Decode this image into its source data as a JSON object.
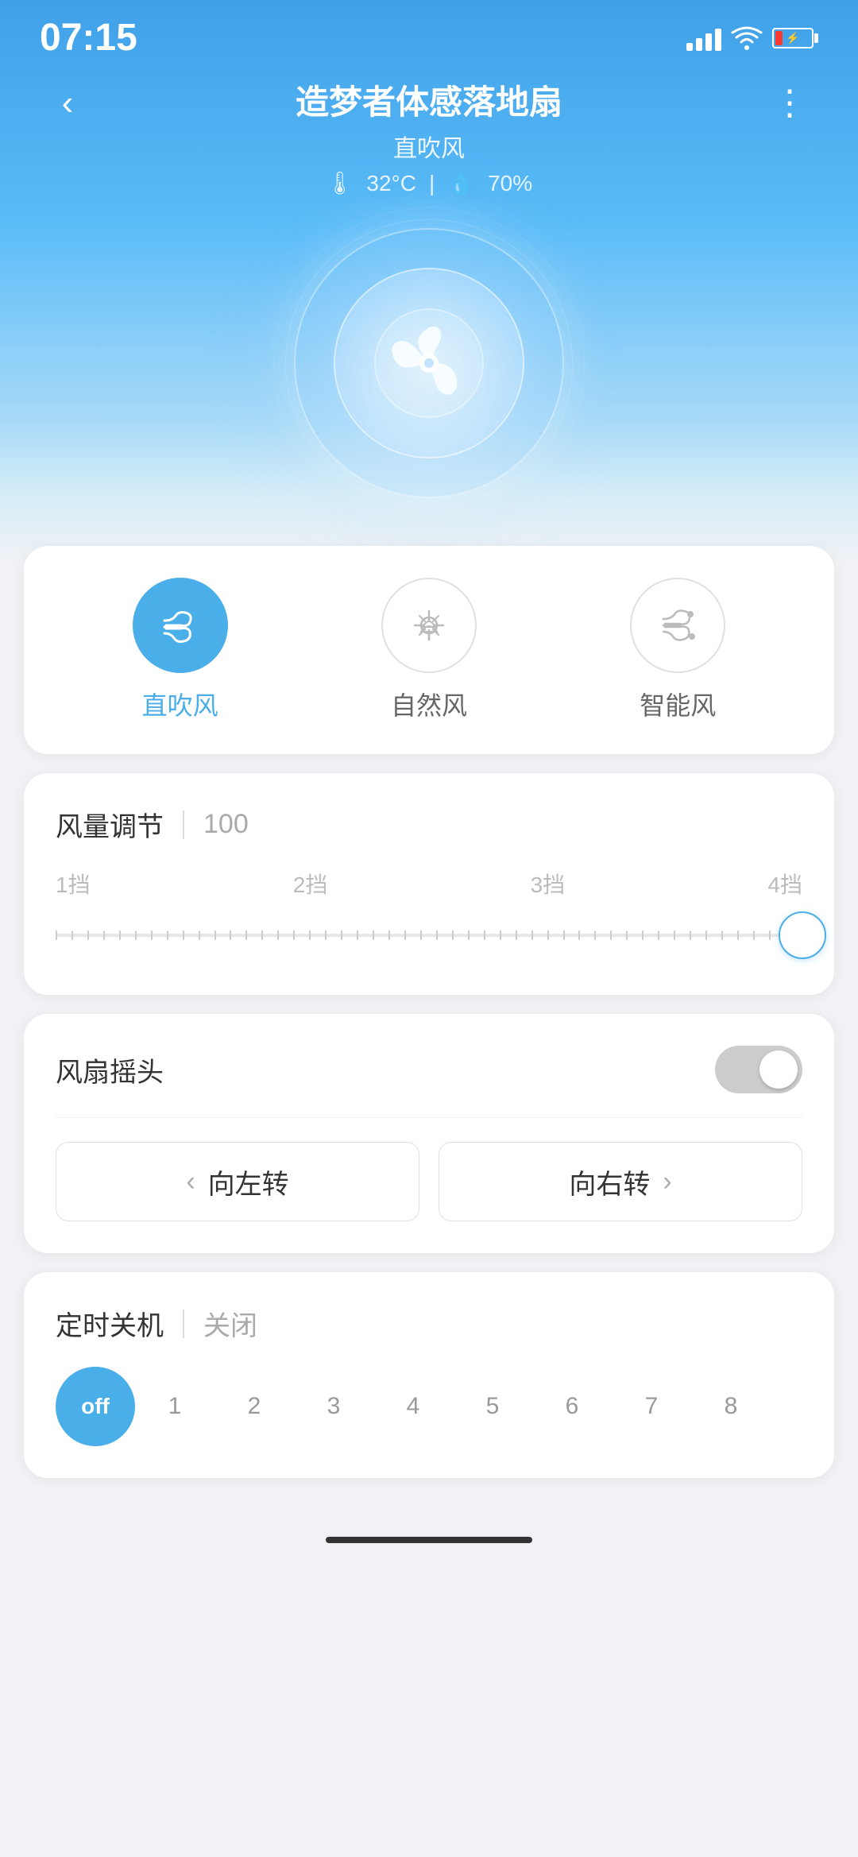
{
  "statusBar": {
    "time": "07:15"
  },
  "header": {
    "title": "造梦者体感落地扇",
    "subtitle": "直吹风",
    "temperature": "32°C",
    "humidity": "70%",
    "backLabel": "<",
    "moreLabel": "⋮"
  },
  "windModes": {
    "items": [
      {
        "id": "direct",
        "label": "直吹风",
        "icon": "≋",
        "active": true
      },
      {
        "id": "natural",
        "label": "自然风",
        "icon": "🌿",
        "active": false
      },
      {
        "id": "smart",
        "label": "智能风",
        "icon": "≋",
        "active": false
      }
    ]
  },
  "speedControl": {
    "title": "风量调节",
    "value": "100",
    "labels": [
      "1挡",
      "2挡",
      "3挡",
      "4挡"
    ],
    "sliderPosition": 100
  },
  "headShake": {
    "title": "风扇摇头",
    "toggleOn": false,
    "leftBtn": "向左转",
    "rightBtn": "向右转",
    "leftIcon": "<",
    "rightIcon": ">"
  },
  "timer": {
    "title": "定时关机",
    "status": "关闭",
    "options": [
      "off",
      "1",
      "2",
      "3",
      "4",
      "5",
      "6",
      "7",
      "8"
    ],
    "activeOption": "off"
  }
}
